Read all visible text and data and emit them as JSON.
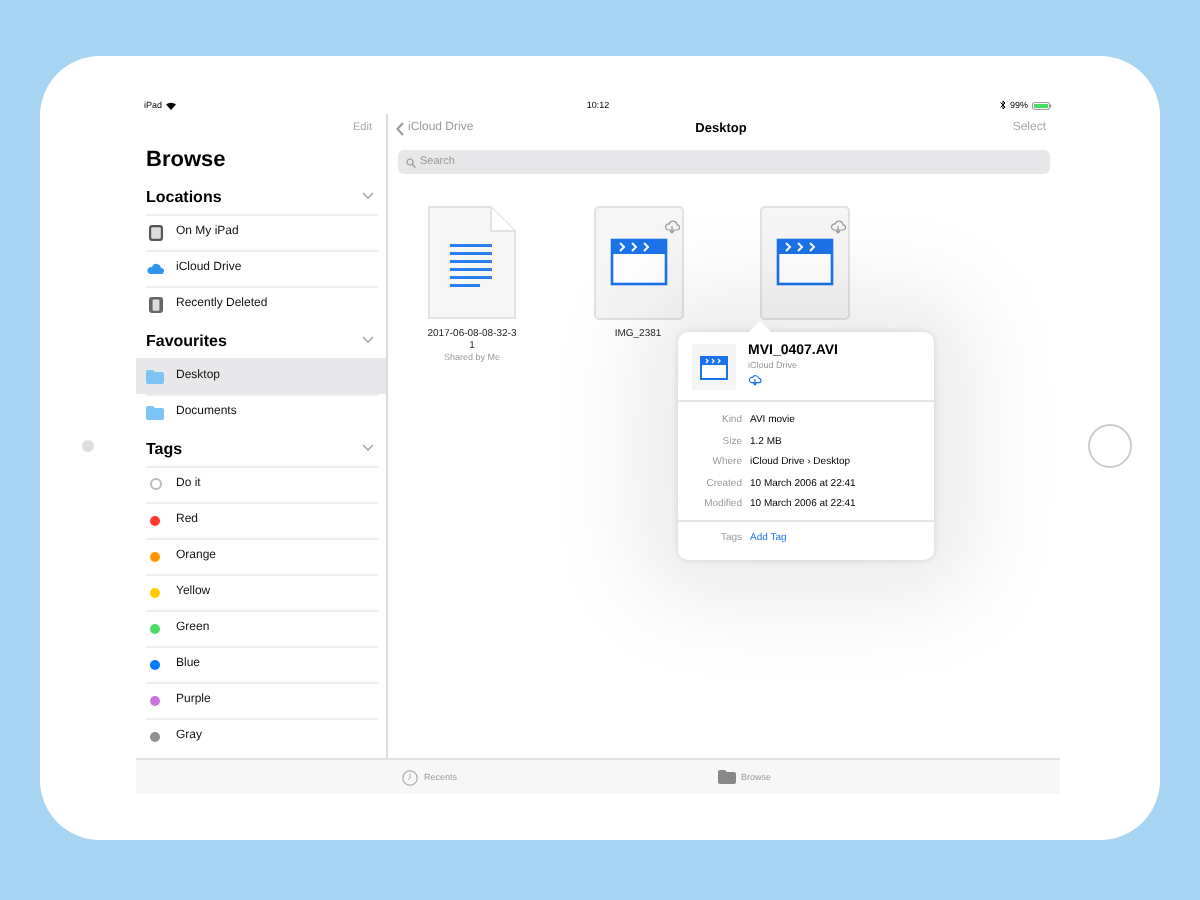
{
  "status_bar": {
    "device": "iPad",
    "time": "10:12",
    "battery": "99%"
  },
  "sidebar": {
    "edit": "Edit",
    "title": "Browse",
    "sections": [
      {
        "title": "Locations",
        "expanded": true,
        "items": [
          {
            "label": "On My iPad",
            "kind": "ipad",
            "selected": false
          },
          {
            "label": "iCloud Drive",
            "kind": "cloud",
            "selected": false
          },
          {
            "label": "Recently Deleted",
            "kind": "trash",
            "selected": false
          }
        ]
      },
      {
        "title": "Favourites",
        "expanded": true,
        "items": [
          {
            "label": "Desktop",
            "kind": "folder",
            "selected": true
          },
          {
            "label": "Documents",
            "kind": "folder",
            "selected": false
          }
        ]
      },
      {
        "title": "Tags",
        "expanded": true,
        "items": [
          {
            "label": "Do it",
            "kind": "untagged",
            "selected": false
          },
          {
            "label": "Red",
            "kind": "tag",
            "color": "#ff3b30",
            "selected": false
          },
          {
            "label": "Orange",
            "kind": "tag",
            "color": "#ff9500",
            "selected": false
          },
          {
            "label": "Yellow",
            "kind": "tag",
            "color": "#ffcc00",
            "selected": false
          },
          {
            "label": "Green",
            "kind": "tag",
            "color": "#4cd964",
            "selected": false
          },
          {
            "label": "Blue",
            "kind": "tag",
            "color": "#007aff",
            "selected": false
          },
          {
            "label": "Purple",
            "kind": "tag",
            "color": "#cc73e1",
            "selected": false
          },
          {
            "label": "Gray",
            "kind": "tag",
            "color": "#8e8e93",
            "selected": false
          }
        ]
      }
    ]
  },
  "main": {
    "back": "iCloud Drive",
    "title": "Desktop",
    "select": "Select",
    "search": {
      "placeholder": "Search"
    },
    "files": [
      {
        "kind": "document",
        "name_lines": [
          "2017-06-08-08-32-3",
          "1"
        ],
        "subtitle": "Shared by Me",
        "in_cloud": false
      },
      {
        "kind": "video",
        "name_lines": [
          "IMG_2381"
        ],
        "in_cloud": true
      },
      {
        "kind": "video",
        "in_cloud": true
      }
    ]
  },
  "popover": {
    "title": "MVI_0407.AVI",
    "location": "iCloud Drive",
    "details": [
      {
        "label": "Kind",
        "value": "AVI movie"
      },
      {
        "label": "Size",
        "value": "1.2 MB"
      },
      {
        "label": "Where",
        "value": "iCloud Drive › Desktop"
      },
      {
        "label": "Created",
        "value": "10 March 2006 at 22:41"
      },
      {
        "label": "Modified",
        "value": "10 March 2006 at 22:41"
      }
    ],
    "tags": {
      "label": "Tags",
      "action": "Add Tag"
    }
  },
  "tab_bar": [
    {
      "label": "Recents",
      "kind": "recents"
    },
    {
      "label": "Browse",
      "kind": "browse"
    }
  ]
}
